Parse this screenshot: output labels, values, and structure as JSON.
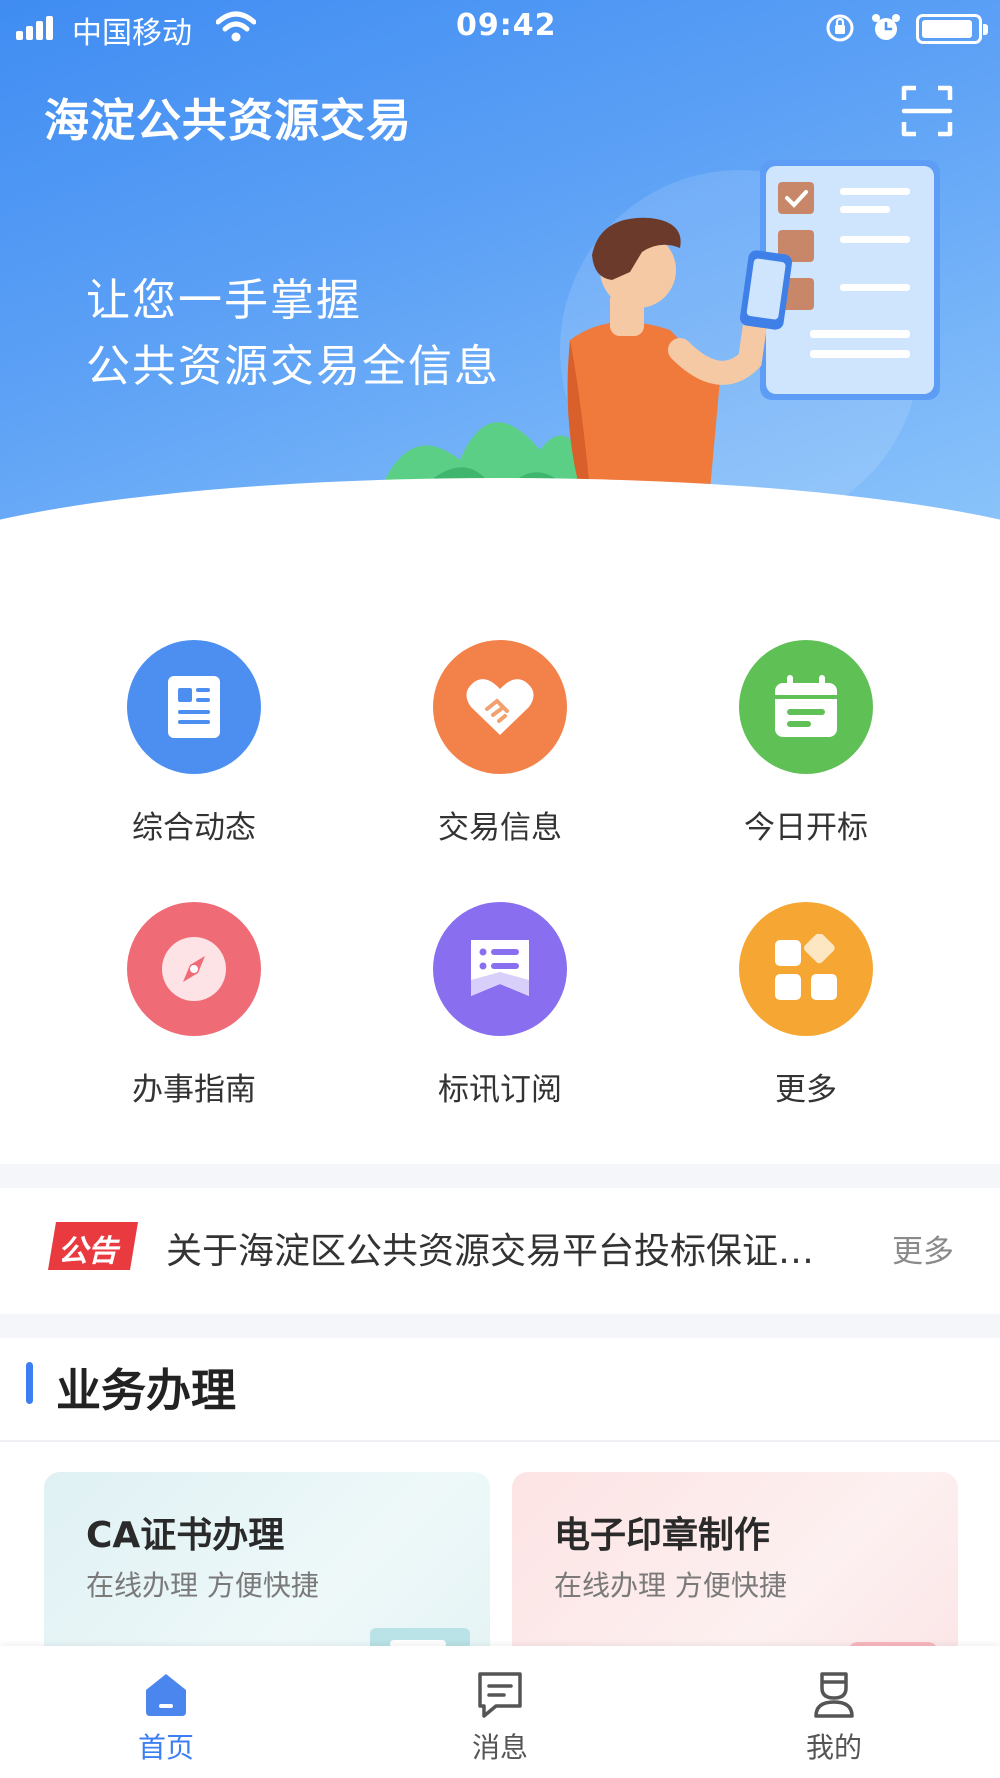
{
  "status_bar": {
    "carrier": "中国移动",
    "time": "09:42",
    "battery_level": 0.92
  },
  "header": {
    "title": "海淀公共资源交易",
    "scan_icon": "scan-icon"
  },
  "hero": {
    "slogan_line1": "让您一手掌握",
    "slogan_line2": "公共资源交易全信息"
  },
  "quick_menu": {
    "items": [
      {
        "label": "综合动态",
        "icon": "news-icon",
        "color": "#4d8ff0"
      },
      {
        "label": "交易信息",
        "icon": "handshake-heart-icon",
        "color": "#f2824a"
      },
      {
        "label": "今日开标",
        "icon": "calendar-icon",
        "color": "#5fc055"
      },
      {
        "label": "办事指南",
        "icon": "compass-icon",
        "color": "#ef6c76"
      },
      {
        "label": "标讯订阅",
        "icon": "subscription-icon",
        "color": "#8a6ef0"
      },
      {
        "label": "更多",
        "icon": "more-grid-icon",
        "color": "#f6a632"
      }
    ]
  },
  "notice": {
    "tag": "公告",
    "text": "关于海淀区公共资源交易平台投标保证…",
    "more": "更多"
  },
  "business": {
    "title": "业务办理",
    "cards": [
      {
        "title": "CA证书办理",
        "subtitle": "在线办理 方便快捷"
      },
      {
        "title": "电子印章制作",
        "subtitle": "在线办理 方便快捷"
      }
    ]
  },
  "tab_bar": {
    "tabs": [
      {
        "label": "首页",
        "icon": "home-icon",
        "active": true
      },
      {
        "label": "消息",
        "icon": "message-icon",
        "active": false
      },
      {
        "label": "我的",
        "icon": "profile-icon",
        "active": false
      }
    ]
  },
  "colors": {
    "accent": "#3d7ff2",
    "notice_tag": "#e83a3f"
  }
}
